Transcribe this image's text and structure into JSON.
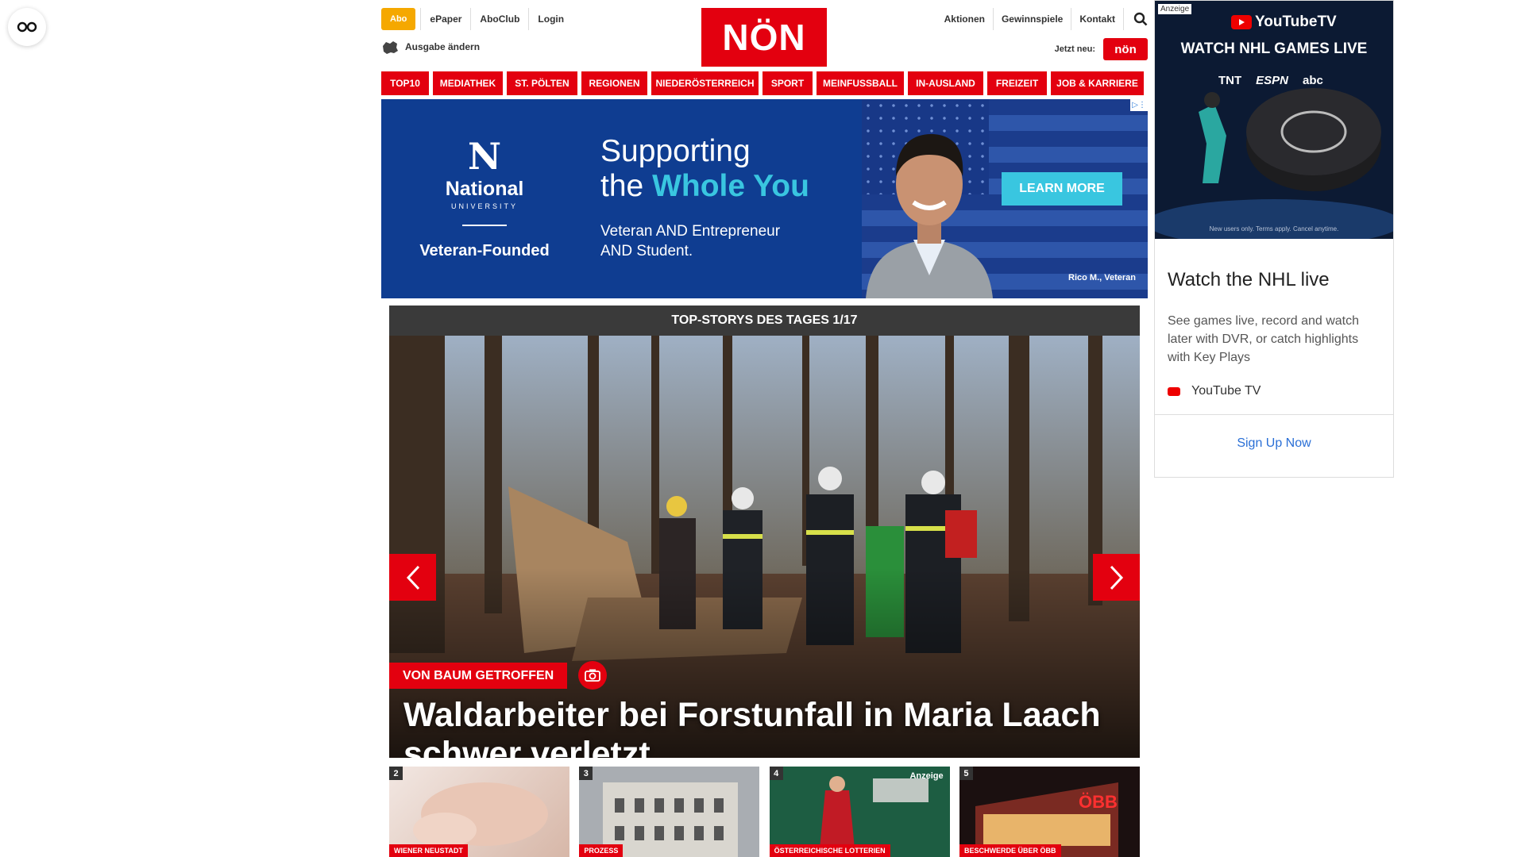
{
  "header": {
    "abo": "Abo",
    "top_links_left": [
      "ePaper",
      "AboClub",
      "Login"
    ],
    "edition": "Ausgabe ändern",
    "logo": "NÖN",
    "top_links_right": [
      "Aktionen",
      "Gewinnspiele",
      "Kontakt"
    ],
    "jetzt_neu": "Jetzt neu:",
    "jetzt_badge": "nön"
  },
  "nav": [
    "TOP10",
    "MEDIATHEK",
    "ST. PÖLTEN",
    "REGIONEN",
    "NIEDERÖSTERREICH",
    "SPORT",
    "MEINFUSSBALL",
    "IN-AUSLAND",
    "FREIZEIT",
    "JOB & KARRIERE"
  ],
  "banner_ad": {
    "logo_letter": "N",
    "logo_name": "National",
    "logo_sub": "UNIVERSITY",
    "tagline": "Veteran-Founded",
    "headline_1": "Supporting",
    "headline_2a": "the ",
    "headline_2b": "Whole You",
    "sub_1": "Veteran AND Entrepreneur",
    "sub_2": "AND Student.",
    "cta": "LEARN MORE",
    "caption": "Rico M., Veteran"
  },
  "slider": {
    "header": "TOP-STORYS DES TAGES 1/17",
    "kicker": "VON BAUM GETROFFEN",
    "headline": "Waldarbeiter bei Forstunfall in Maria Laach schwer verletzt"
  },
  "thumbs": [
    {
      "num": "2",
      "category": "WIENER NEUSTADT",
      "ad": ""
    },
    {
      "num": "3",
      "category": "PROZESS",
      "ad": ""
    },
    {
      "num": "4",
      "category": "ÖSTERREICHISCHE LOTTERIEN",
      "ad": "Anzeige"
    },
    {
      "num": "5",
      "category": "BESCHWERDE ÜBER ÖBB",
      "ad": ""
    }
  ],
  "side_ad": {
    "anzeige": "Anzeige",
    "brand": "YouTubeTV",
    "watch": "WATCH NHL GAMES LIVE",
    "networks": [
      "TNT",
      "ESPN",
      "abc"
    ],
    "fine_print": "New users only. Terms apply. Cancel anytime.",
    "title": "Watch the NHL live",
    "description": "See games live, record and watch later with DVR, or catch highlights with Key Plays",
    "advertiser": "YouTube TV",
    "cta": "Sign Up Now"
  },
  "colors": {
    "brand_red": "#e3000f",
    "abo_orange": "#f5a800",
    "ad_blue": "#0f3d91",
    "ad_cyan": "#39c6e0"
  }
}
